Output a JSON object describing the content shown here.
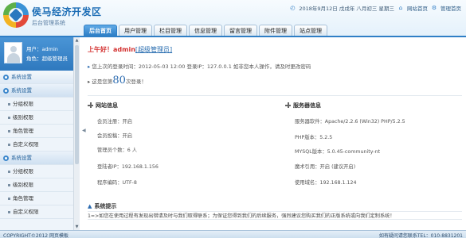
{
  "header": {
    "title": "侯马经济开发区",
    "subtitle": "后台管理系统",
    "date": "2018年9月12日 戊戌年 八月初三 星期三",
    "home_link": "网站首页",
    "admin_home_link": "管理首页"
  },
  "nav": {
    "tabs": [
      {
        "label": "后台首页",
        "active": true
      },
      {
        "label": "用户管理"
      },
      {
        "label": "栏目管理"
      },
      {
        "label": "信息管理"
      },
      {
        "label": "留言管理"
      },
      {
        "label": "附件管理"
      },
      {
        "label": "站点管理"
      }
    ]
  },
  "sidebar": {
    "user_label": "用户：admin",
    "role_label": "角色：超级管理员",
    "items": [
      {
        "label": "系统设置",
        "type": "group"
      },
      {
        "label": "系统设置",
        "type": "group"
      },
      {
        "label": "分组权限",
        "type": "item"
      },
      {
        "label": "级别权限",
        "type": "item"
      },
      {
        "label": "角色管理",
        "type": "item"
      },
      {
        "label": "自定义权限",
        "type": "item"
      },
      {
        "label": "系统设置",
        "type": "group"
      },
      {
        "label": "分组权限",
        "type": "item"
      },
      {
        "label": "级别权限",
        "type": "item"
      },
      {
        "label": "角色管理",
        "type": "item"
      },
      {
        "label": "自定义权限",
        "type": "item"
      }
    ]
  },
  "main": {
    "greeting": "上午好！admin",
    "role": "[超级管理员]",
    "last_login": "您上次的登录时间：2012-05-03 12:00 登录IP：127.0.0.1    如非您本人操作，请及时更改密码",
    "visits_prefix": "这是您第",
    "visits_count": "80",
    "visits_suffix": "次登录！",
    "site_info": {
      "title": "网站信息",
      "rows": [
        "会员注册：开启",
        "会员投稿：开启",
        "管理员个数：6 人",
        "登陆者IP：192.168.1.156",
        "程序编码：UTF-8"
      ]
    },
    "server_info": {
      "title": "服务器信息",
      "rows": [
        "服务器软件：Apache/2.2.6 (Win32) PHP/5.2.5",
        "PHP版本：5.2.5",
        "MYSQL版本：5.0.45-community-nt",
        "魔术引用：开启 (建议开启)",
        "使用域名：192.168.1.124"
      ]
    },
    "system_tip": {
      "title": "系统提示",
      "text": "1=>如您在使用过程有发现出错请及时与我们取得联系；为保证您得到我们的后续服务，强烈建议您购买我们的正版系统或向我们定制系统！"
    }
  },
  "footer": {
    "copyright": "COPYRIGHT©2012 网页模板",
    "contact": "如有疑问请您联系TEL：010-8831201"
  }
}
